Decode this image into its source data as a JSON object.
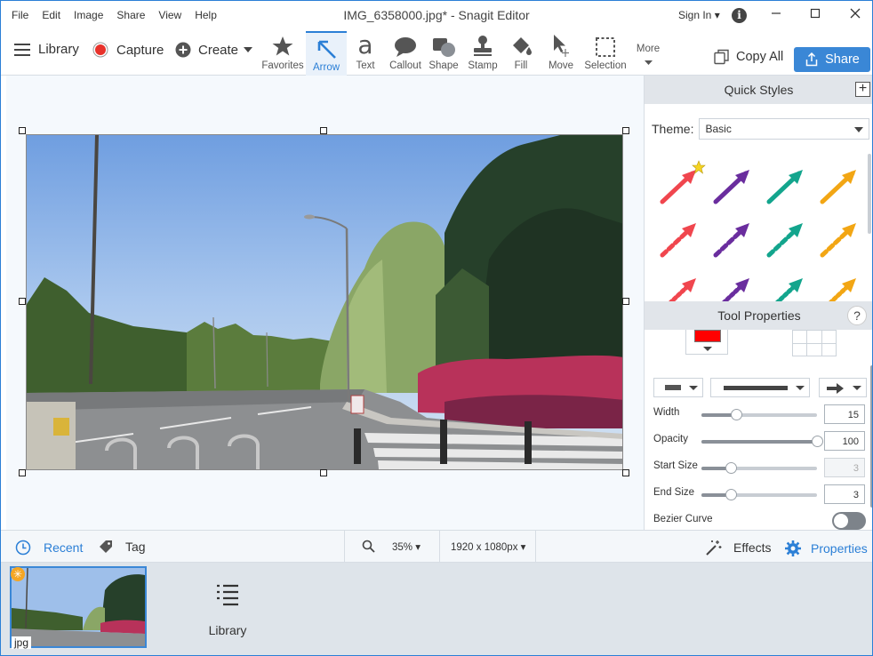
{
  "menu": [
    "File",
    "Edit",
    "Image",
    "Share",
    "View",
    "Help"
  ],
  "window": {
    "title": "IMG_6358000.jpg* - Snagit Editor",
    "signin": "Sign In ▾",
    "info_label": "i"
  },
  "toolbar": {
    "library": "Library",
    "capture": "Capture",
    "create": "Create",
    "tools": [
      "Favorites",
      "Arrow",
      "Text",
      "Callout",
      "Shape",
      "Stamp",
      "Fill",
      "Move",
      "Selection"
    ],
    "more": "More",
    "text_glyph": "a",
    "copy_all": "Copy All",
    "share": "Share"
  },
  "quick_styles": {
    "title": "Quick Styles",
    "plus": "+",
    "theme_label": "Theme:",
    "theme_value": "Basic",
    "colors": [
      "#f0464e",
      "#6a2d9e",
      "#13a58d",
      "#f2a614"
    ]
  },
  "tool_properties": {
    "title": "Tool Properties",
    "help": "?",
    "color": "#ff0000",
    "width": {
      "label": "Width",
      "value": "15",
      "level": 0.3
    },
    "opacity": {
      "label": "Opacity",
      "value": "100",
      "level": 1.0
    },
    "start_size": {
      "label": "Start Size",
      "value": "3",
      "level": 0.25
    },
    "end_size": {
      "label": "End Size",
      "value": "3",
      "level": 0.25
    },
    "bezier": {
      "label": "Bezier Curve"
    }
  },
  "bottom": {
    "recent": "Recent",
    "tag": "Tag",
    "zoom": "35% ▾",
    "dimensions": "1920 x 1080px ▾",
    "effects": "Effects",
    "properties": "Properties"
  },
  "tray": {
    "thumb_label": "jpg",
    "library": "Library",
    "star": "✳"
  }
}
